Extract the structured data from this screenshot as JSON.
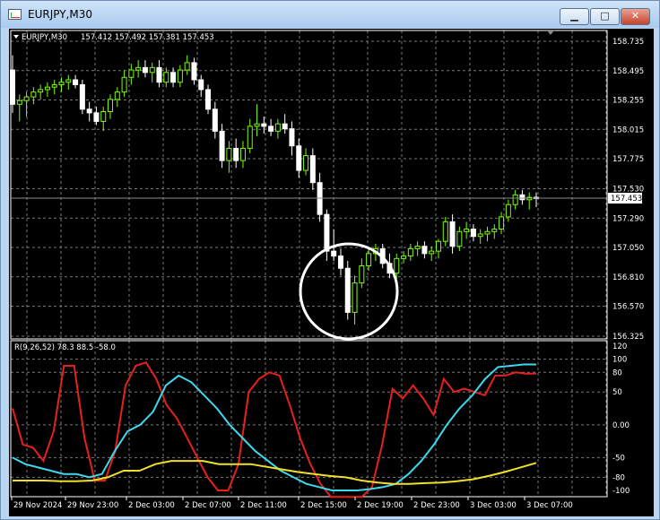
{
  "window": {
    "title": "EURJPY,M30",
    "minimize_label": "▁",
    "maximize_label": "□",
    "close_label": "✕"
  },
  "chart_header": {
    "symbol_tf": "EURJPY,M30",
    "ohlc": "157.412 157.492 157.381 157.453"
  },
  "price_axis": {
    "labels": [
      "158.735",
      "158.495",
      "158.255",
      "158.015",
      "157.775",
      "157.530",
      "157.290",
      "157.050",
      "156.810",
      "156.570",
      "156.325"
    ],
    "current_price": "157.453"
  },
  "indicator": {
    "header": "R(9,26,52) 78.3 88.5 -58.0",
    "labels": [
      "120",
      "100",
      "80",
      "50",
      "0.00",
      "-50",
      "-80",
      "-100"
    ]
  },
  "time_axis": {
    "labels": [
      "29 Nov 2024",
      "29 Nov 23:00",
      "2 Dec 03:00",
      "2 Dec 07:00",
      "2 Dec 11:00",
      "2 Dec 15:00",
      "2 Dec 19:00",
      "2 Dec 23:00",
      "3 Dec 03:00",
      "3 Dec 07:00"
    ]
  },
  "colors": {
    "background": "#000000",
    "grid": "#a0a0a0",
    "bull": "#7cfc00",
    "bear": "#ffffff",
    "line_red": "#e8201c",
    "line_cyan": "#3ed9ef",
    "line_yellow": "#f0e02a",
    "annotation_circle": "#ffffff"
  },
  "chart_data": {
    "type": "candlestick",
    "symbol": "EURJPY",
    "timeframe": "M30",
    "ylim": [
      156.325,
      158.735
    ],
    "candles": [
      [
        158.5,
        158.62,
        158.15,
        158.22
      ],
      [
        158.22,
        158.3,
        158.08,
        158.25
      ],
      [
        158.25,
        158.32,
        158.12,
        158.28
      ],
      [
        158.28,
        158.36,
        158.22,
        158.32
      ],
      [
        158.32,
        158.38,
        158.26,
        158.34
      ],
      [
        158.34,
        158.4,
        158.28,
        158.36
      ],
      [
        158.36,
        158.42,
        158.3,
        158.38
      ],
      [
        158.38,
        158.44,
        158.32,
        158.4
      ],
      [
        158.4,
        158.46,
        158.34,
        158.42
      ],
      [
        158.42,
        158.46,
        158.35,
        158.38
      ],
      [
        158.38,
        158.42,
        158.14,
        158.18
      ],
      [
        158.18,
        158.24,
        158.08,
        158.15
      ],
      [
        158.15,
        158.2,
        158.05,
        158.08
      ],
      [
        158.08,
        158.2,
        158.0,
        158.16
      ],
      [
        158.16,
        158.3,
        158.1,
        158.26
      ],
      [
        158.26,
        158.36,
        158.2,
        158.32
      ],
      [
        158.32,
        158.5,
        158.28,
        158.44
      ],
      [
        158.44,
        158.55,
        158.38,
        158.5
      ],
      [
        158.5,
        158.58,
        158.44,
        158.52
      ],
      [
        158.52,
        158.58,
        158.44,
        158.48
      ],
      [
        158.48,
        158.56,
        158.4,
        158.52
      ],
      [
        158.52,
        158.58,
        158.36,
        158.4
      ],
      [
        158.4,
        158.52,
        158.36,
        158.48
      ],
      [
        158.48,
        158.52,
        158.36,
        158.4
      ],
      [
        158.4,
        158.54,
        158.36,
        158.5
      ],
      [
        158.5,
        158.62,
        158.46,
        158.56
      ],
      [
        158.56,
        158.6,
        158.38,
        158.42
      ],
      [
        158.42,
        158.46,
        158.28,
        158.34
      ],
      [
        158.34,
        158.38,
        158.14,
        158.18
      ],
      [
        158.18,
        158.24,
        157.94,
        158.0
      ],
      [
        158.0,
        158.06,
        157.7,
        157.76
      ],
      [
        157.76,
        157.92,
        157.66,
        157.86
      ],
      [
        157.86,
        157.94,
        157.7,
        157.76
      ],
      [
        157.76,
        157.92,
        157.7,
        157.86
      ],
      [
        157.86,
        158.1,
        157.82,
        158.04
      ],
      [
        158.04,
        158.22,
        157.96,
        158.06
      ],
      [
        158.06,
        158.12,
        157.98,
        158.04
      ],
      [
        158.04,
        158.1,
        157.96,
        158.0
      ],
      [
        158.0,
        158.1,
        157.94,
        158.06
      ],
      [
        158.06,
        158.14,
        157.98,
        158.02
      ],
      [
        158.02,
        158.08,
        157.8,
        157.88
      ],
      [
        157.88,
        157.94,
        157.62,
        157.68
      ],
      [
        157.68,
        157.86,
        157.64,
        157.8
      ],
      [
        157.8,
        157.86,
        157.52,
        157.58
      ],
      [
        157.58,
        157.66,
        157.26,
        157.32
      ],
      [
        157.32,
        157.36,
        156.94,
        157.02
      ],
      [
        157.02,
        157.2,
        156.94,
        156.98
      ],
      [
        156.98,
        157.04,
        156.82,
        156.88
      ],
      [
        156.88,
        156.94,
        156.46,
        156.52
      ],
      [
        156.52,
        156.82,
        156.42,
        156.76
      ],
      [
        156.76,
        156.96,
        156.72,
        156.9
      ],
      [
        156.9,
        157.04,
        156.86,
        157.0
      ],
      [
        157.0,
        157.08,
        156.94,
        157.04
      ],
      [
        157.04,
        157.08,
        156.88,
        156.92
      ],
      [
        156.92,
        157.0,
        156.8,
        156.84
      ],
      [
        156.84,
        157.0,
        156.8,
        156.96
      ],
      [
        156.96,
        157.02,
        156.92,
        156.98
      ],
      [
        156.98,
        157.08,
        156.94,
        157.04
      ],
      [
        157.04,
        157.1,
        156.98,
        157.06
      ],
      [
        157.06,
        157.1,
        156.96,
        157.0
      ],
      [
        157.0,
        157.06,
        156.94,
        157.02
      ],
      [
        157.02,
        157.12,
        156.96,
        157.1
      ],
      [
        157.1,
        157.3,
        157.06,
        157.26
      ],
      [
        157.26,
        157.32,
        157.0,
        157.06
      ],
      [
        157.06,
        157.22,
        157.02,
        157.18
      ],
      [
        157.18,
        157.26,
        157.12,
        157.2
      ],
      [
        157.2,
        157.24,
        157.1,
        157.14
      ],
      [
        157.14,
        157.2,
        157.08,
        157.16
      ],
      [
        157.16,
        157.22,
        157.1,
        157.18
      ],
      [
        157.18,
        157.24,
        157.12,
        157.2
      ],
      [
        157.2,
        157.34,
        157.16,
        157.3
      ],
      [
        157.3,
        157.44,
        157.26,
        157.4
      ],
      [
        157.4,
        157.52,
        157.36,
        157.48
      ],
      [
        157.48,
        157.52,
        157.4,
        157.44
      ],
      [
        157.44,
        157.5,
        157.36,
        157.46
      ],
      [
        157.46,
        157.5,
        157.38,
        157.45
      ]
    ],
    "indicator": {
      "name": "R(9,26,52)",
      "values": [
        78.3,
        88.5,
        -58.0
      ],
      "ylim": [
        -100,
        120
      ],
      "series": [
        {
          "color": "red",
          "values": [
            25,
            -30,
            -35,
            -55,
            -10,
            90,
            90,
            -20,
            -85,
            -85,
            -40,
            60,
            90,
            95,
            70,
            30,
            10,
            -20,
            -50,
            -80,
            -100,
            -100,
            -60,
            50,
            70,
            80,
            75,
            30,
            -20,
            -60,
            -90,
            -110,
            -110,
            -110,
            -110,
            -95,
            -30,
            55,
            40,
            60,
            40,
            15,
            70,
            50,
            55,
            50,
            45,
            75,
            75,
            80,
            78,
            78
          ]
        },
        {
          "color": "cyan",
          "values": [
            -50,
            -60,
            -65,
            -70,
            -75,
            -75,
            -80,
            -75,
            -40,
            -10,
            0,
            20,
            60,
            75,
            65,
            45,
            25,
            0,
            -20,
            -40,
            -55,
            -70,
            -80,
            -90,
            -95,
            -100,
            -100,
            -100,
            -98,
            -95,
            -90,
            -75,
            -55,
            -30,
            0,
            25,
            45,
            70,
            88,
            90,
            92,
            92
          ]
        },
        {
          "color": "yellow",
          "values": [
            -85,
            -85,
            -85,
            -86,
            -86,
            -85,
            -80,
            -70,
            -70,
            -60,
            -55,
            -55,
            -55,
            -60,
            -60,
            -60,
            -64,
            -68,
            -72,
            -75,
            -78,
            -80,
            -85,
            -88,
            -90,
            -90,
            -89,
            -88,
            -86,
            -83,
            -78,
            -72,
            -65,
            -58
          ]
        }
      ]
    }
  }
}
